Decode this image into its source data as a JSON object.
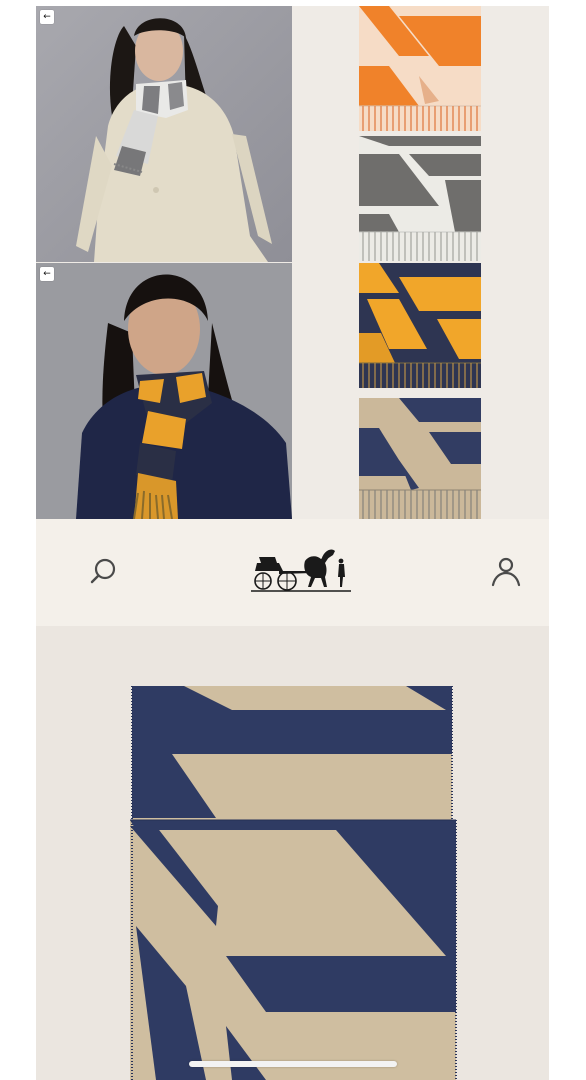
{
  "app": {
    "brand": "Hermès"
  },
  "gallery": {
    "photos": [
      {
        "name": "model-grey-scarf",
        "back_label": "←"
      },
      {
        "name": "model-navy-orange-scarf",
        "back_label": "←"
      }
    ],
    "swatches": [
      {
        "name": "orange-cream-colorway",
        "colors": [
          "#f0822a",
          "#f6dcc6"
        ]
      },
      {
        "name": "grey-white-colorway",
        "colors": [
          "#6f6e6c",
          "#ecebe6"
        ]
      },
      {
        "name": "navy-yellow-colorway",
        "colors": [
          "#2e3552",
          "#f1a62a"
        ]
      },
      {
        "name": "navy-beige-colorway",
        "colors": [
          "#323d63",
          "#cbb89a"
        ]
      }
    ]
  },
  "navbar": {
    "search_icon": "search-icon",
    "logo": "hermes-carriage-logo",
    "account_icon": "user-icon"
  },
  "product": {
    "image": "navy-beige-cashmere-scarf",
    "colors": {
      "navy": "#2f3b63",
      "beige": "#cfbea0",
      "background": "#ebe6e0"
    }
  }
}
